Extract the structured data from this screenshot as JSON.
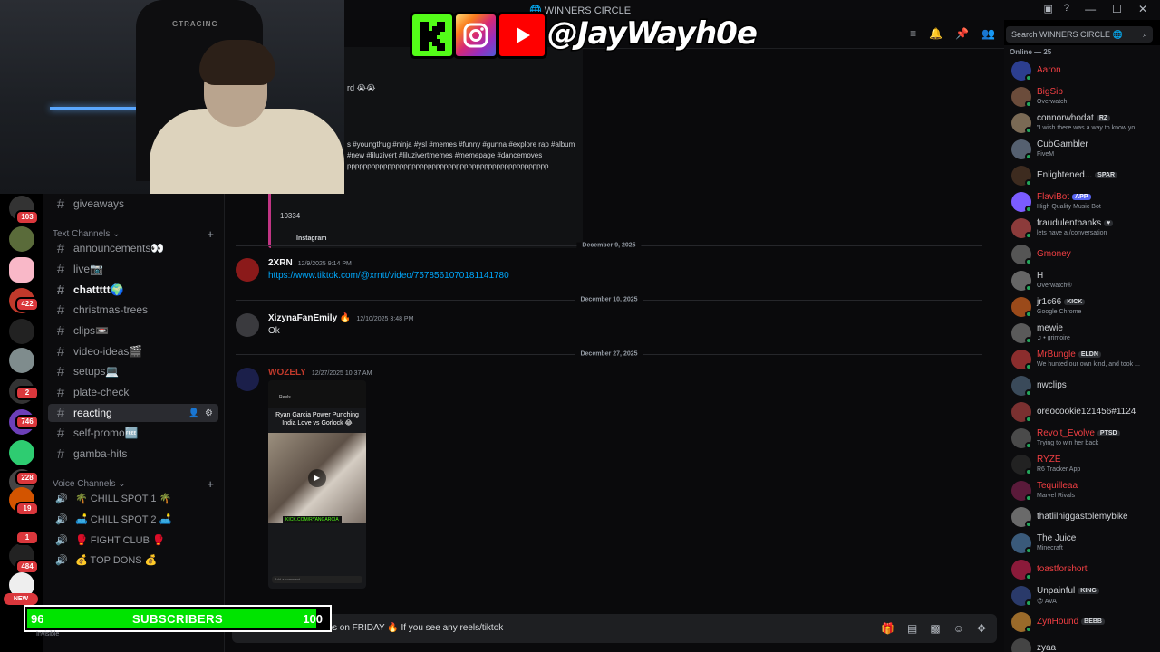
{
  "window": {
    "title": "WINNERS CIRCLE",
    "title_emoji": "🌐"
  },
  "search": {
    "placeholder": "Search WINNERS CIRCLE 🌐"
  },
  "rail": {
    "badges": [
      "103",
      "422",
      "2",
      "746",
      "228",
      "19",
      "1",
      "484"
    ],
    "new_label": "NEW"
  },
  "channels": {
    "top_item": "giveaways",
    "text_category": "Text Channels",
    "text": [
      {
        "label": "announcements👀"
      },
      {
        "label": "live📷"
      },
      {
        "label": "chattttt🌍"
      },
      {
        "label": "christmas-trees"
      },
      {
        "label": "clips📼"
      },
      {
        "label": "video-ideas🎬"
      },
      {
        "label": "setups💻"
      },
      {
        "label": "plate-check"
      },
      {
        "label": "reacting"
      },
      {
        "label": "self-promo🆓"
      },
      {
        "label": "gamba-hits"
      }
    ],
    "voice_category": "Voice Channels",
    "voice": [
      {
        "label": "🌴 CHILL SPOT 1 🌴"
      },
      {
        "label": "🛋️ CHILL SPOT 2 🛋️"
      },
      {
        "label": "🥊 FIGHT CLUB 🥊"
      },
      {
        "label": "💰 TOP DONS 💰"
      }
    ]
  },
  "embed": {
    "fragment": "rd 😭😭",
    "tags": "s #youngthug #ninja #ysl #memes #funny #gunna #explore rap #album #new #liluzivert #liluzivertmemes #memepage #dancemoves pppppppppppppppppppppppppppppppppppppppppppppppppp",
    "count": "10334",
    "source": "Instagram"
  },
  "dividers": [
    "December 9, 2025",
    "December 10, 2025",
    "December 27, 2025"
  ],
  "messages": [
    {
      "author": "2XRN",
      "time": "12/9/2025 9:14 PM",
      "body": "https://www.tiktok.com/@xrntt/video/7578561070181141780"
    },
    {
      "author": "XizynaFanEmily 🔥",
      "time": "12/10/2025 3:48 PM",
      "body": "Ok"
    },
    {
      "author": "WOZELY",
      "time": "12/27/2025 10:37 AM",
      "body": ""
    }
  ],
  "reel": {
    "header": "Reels",
    "title": "Ryan Garcia Power Punching India Love vs Gorlock 😂",
    "kick": "KICK.COM/RYANGARCIA",
    "comment": "Add a comment"
  },
  "composer": {
    "text": "clips on FRIDAY 🔥 If you see any reels/tiktok"
  },
  "members": {
    "header": "Online — 25",
    "list": [
      {
        "name": "Aaron",
        "color": "#f23f43",
        "status": "",
        "tag": ""
      },
      {
        "name": "BigSip",
        "color": "#f23f43",
        "status": "Overwatch",
        "tag": ""
      },
      {
        "name": "connorwhodat",
        "color": "#cfd2d6",
        "status": "\"I wish there was a way to know yo...",
        "tag": "RZ"
      },
      {
        "name": "CubGambler",
        "color": "#cfd2d6",
        "status": "FiveM",
        "tag": ""
      },
      {
        "name": "Enlightened...",
        "color": "#cfd2d6",
        "status": "",
        "tag": "SPAR"
      },
      {
        "name": "FlaviBot",
        "color": "#f23f43",
        "status": "High Quality Music Bot",
        "tag": "APP"
      },
      {
        "name": "fraudulentbanks",
        "color": "#cfd2d6",
        "status": "lets have a /conversation",
        "tag": "♥"
      },
      {
        "name": "Gmoney",
        "color": "#f23f43",
        "status": "",
        "tag": ""
      },
      {
        "name": "H",
        "color": "#cfd2d6",
        "status": "Overwatch®",
        "tag": ""
      },
      {
        "name": "jr1c66",
        "color": "#cfd2d6",
        "status": "Google Chrome",
        "tag": "KICK"
      },
      {
        "name": "mewie",
        "color": "#cfd2d6",
        "status": "♫ • grimoire",
        "tag": ""
      },
      {
        "name": "MrBungle",
        "color": "#f23f43",
        "status": "We hunted our own kind, and took ...",
        "tag": "ELDN"
      },
      {
        "name": "nwclips",
        "color": "#cfd2d6",
        "status": "",
        "tag": ""
      },
      {
        "name": "oreocookie121456#1124",
        "color": "#cfd2d6",
        "status": "",
        "tag": ""
      },
      {
        "name": "Revolt_Evolve",
        "color": "#f23f43",
        "status": "Trying to win her back",
        "tag": "PTSD"
      },
      {
        "name": "RYZE",
        "color": "#f23f43",
        "status": "R6 Tracker App",
        "tag": ""
      },
      {
        "name": "Tequilleaa",
        "color": "#f23f43",
        "status": "Marvel Rivals",
        "tag": ""
      },
      {
        "name": "thatlilniggastolemybike",
        "color": "#cfd2d6",
        "status": "",
        "tag": ""
      },
      {
        "name": "The Juice",
        "color": "#cfd2d6",
        "status": "Minecraft",
        "tag": ""
      },
      {
        "name": "toastforshort",
        "color": "#f23f43",
        "status": "",
        "tag": ""
      },
      {
        "name": "Unpainful",
        "color": "#cfd2d6",
        "status": "😍 AVA",
        "tag": "KING"
      },
      {
        "name": "ZynHound",
        "color": "#f23f43",
        "status": "",
        "tag": "BEBB"
      },
      {
        "name": "zyaa",
        "color": "#cfd2d6",
        "status": "",
        "tag": ""
      }
    ]
  },
  "overlay": {
    "handle": "@JayWayh0e",
    "brand": "GTRACING",
    "sub_current": "96",
    "sub_label": "SUBSCRIBERS",
    "sub_goal": "100",
    "sub_progress": 0.96
  },
  "user_status": "Invisible",
  "colors": {
    "accent": "#5865f2",
    "link": "#00a8fc",
    "bar_green": "#00e400",
    "danger": "#f23f43"
  }
}
